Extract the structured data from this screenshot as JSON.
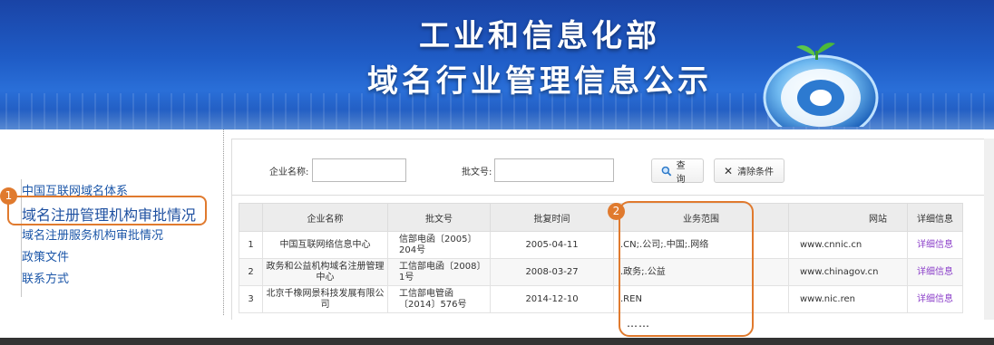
{
  "banner": {
    "title_line1": "工业和信息化部",
    "title_line2": "域名行业管理信息公示",
    "logo_icon": "at-sign-globe-icon"
  },
  "sidebar": {
    "items": [
      {
        "label": "中国互联网域名体系"
      },
      {
        "label": "域名注册管理机构审批情况"
      },
      {
        "label": "域名注册服务机构审批情况"
      },
      {
        "label": "政策文件"
      },
      {
        "label": "联系方式"
      }
    ],
    "active_index": 1
  },
  "search": {
    "company_label": "企业名称:",
    "doc_label": "批文号:",
    "company_value": "",
    "doc_value": "",
    "query_label": "查询",
    "clear_label": "清除条件"
  },
  "table": {
    "headers": [
      "",
      "企业名称",
      "批文号",
      "批复时间",
      "业务范围",
      "网站",
      "详细信息"
    ],
    "rows": [
      {
        "idx": "1",
        "name": "中国互联网络信息中心",
        "doc": "信部电函〔2005〕204号",
        "date": "2005-04-11",
        "scope": ".CN;.公司;.中国;.网络",
        "site": "www.cnnic.cn",
        "detail": "详细信息"
      },
      {
        "idx": "2",
        "name": "政务和公益机构域名注册管理中心",
        "doc": "工信部电函〔2008〕1号",
        "date": "2008-03-27",
        "scope": ".政务;.公益",
        "site": "www.chinagov.cn",
        "detail": "详细信息"
      },
      {
        "idx": "3",
        "name": "北京千橡网景科技发展有限公司",
        "doc": "工信部电管函〔2014〕576号",
        "date": "2014-12-10",
        "scope": ".REN",
        "site": "www.nic.ren",
        "detail": "详细信息"
      }
    ]
  },
  "annotations": {
    "badge1": "1",
    "badge2": "2",
    "ellipsis": "……",
    "highlight_color": "#e07a2e"
  },
  "colors": {
    "banner_blue": "#1f5cc6",
    "nav_link": "#1b56a8",
    "detail_link": "#8b3fc9"
  }
}
